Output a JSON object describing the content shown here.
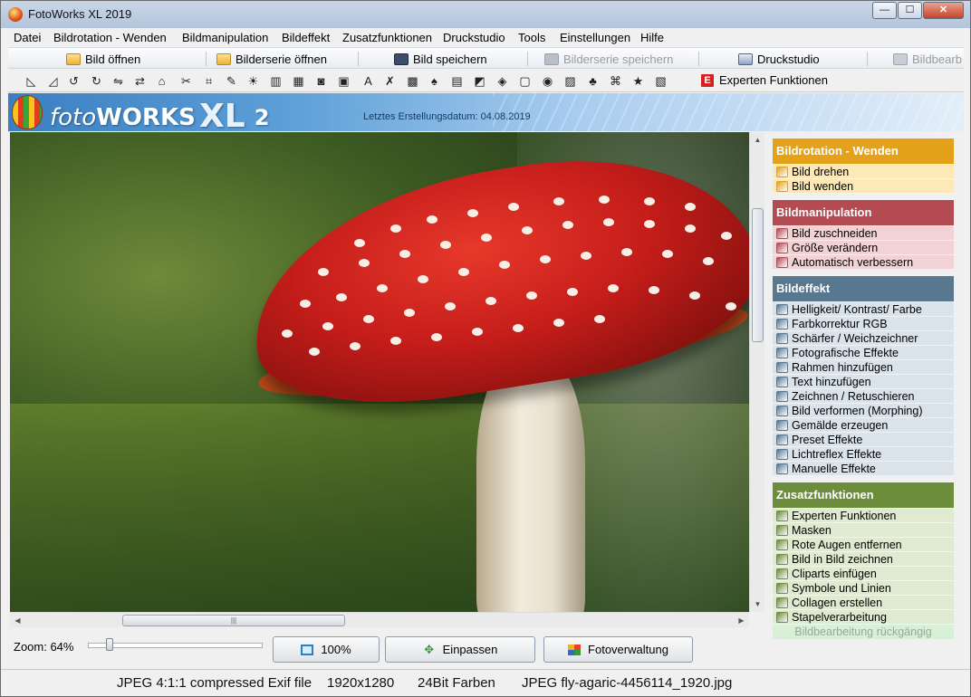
{
  "window": {
    "title": "FotoWorks XL 2019",
    "controls": {
      "minimize": "—",
      "maximize": "☐",
      "close": "✕"
    }
  },
  "menu": [
    "Datei",
    "Bildrotation - Wenden",
    "Bildmanipulation",
    "Bildeffekt",
    "Zusatzfunktionen",
    "Druckstudio",
    "Tools",
    "Einstellungen",
    "Hilfe"
  ],
  "toolbar": {
    "open_image": "Bild öffnen",
    "open_series": "Bilderserie öffnen",
    "save_image": "Bild speichern",
    "save_series": "Bilderserie speichern",
    "print_studio": "Druckstudio",
    "edit_cut": "Bildbearb"
  },
  "icon_toolbar": {
    "icons": [
      "rotate-left-icon",
      "rotate-right-icon",
      "rotate-ccw-icon",
      "rotate-cw-icon",
      "flip-icon",
      "mirror-icon",
      "perspective-icon",
      "scissors-icon",
      "crop-icon",
      "auto-enhance-icon",
      "brightness-icon",
      "rgb-icon",
      "sharpen-icon",
      "photo-effect-icon",
      "frame-icon",
      "text-icon",
      "retouch-icon",
      "morph-icon",
      "paint-icon",
      "preset-icon",
      "lens-flare-icon",
      "manual-effect-icon",
      "mask-icon",
      "red-eye-icon",
      "picture-in-picture-icon",
      "clipart-icon",
      "symbols-icon",
      "collage-icon",
      "batch-icon"
    ],
    "glyphs": [
      "◺",
      "◿",
      "↺",
      "↻",
      "⇋",
      "⇄",
      "⌂",
      "✂",
      "⌗",
      "✎",
      "☀",
      "▥",
      "▦",
      "◙",
      "▣",
      "A",
      "✗",
      "▩",
      "♠",
      "▤",
      "◩",
      "◈",
      "▢",
      "◉",
      "▨",
      "♣",
      "⌘",
      "★",
      "▧"
    ],
    "expert_label": "Experten Funktionen",
    "expert_badge": "E"
  },
  "banner": {
    "logo_foto": "foto",
    "logo_works": "WORKS",
    "logo_xl": "XL",
    "logo_version": "2",
    "date_label": "Letztes Erstellungsdatum: 04.08.2019"
  },
  "zoom": {
    "label": "Zoom: 64%",
    "level": 0.64,
    "btn_100": "100%",
    "btn_fit": "Einpassen",
    "btn_manager": "Fotoverwaltung"
  },
  "side_panel": {
    "sections": [
      {
        "title": "Bildrotation - Wenden",
        "color": "#e4a21a",
        "item_bg": "#fde8b8",
        "items": [
          {
            "label": "Bild drehen",
            "icon": "rotate-image-icon"
          },
          {
            "label": "Bild wenden",
            "icon": "flip-image-icon"
          }
        ]
      },
      {
        "title": "Bildmanipulation",
        "color": "#b44a52",
        "item_bg": "#f2d3d5",
        "items": [
          {
            "label": "Bild zuschneiden",
            "icon": "crop-icon"
          },
          {
            "label": "Größe verändern",
            "icon": "resize-icon"
          },
          {
            "label": "Automatisch verbessern",
            "icon": "auto-enhance-icon"
          }
        ]
      },
      {
        "title": "Bildeffekt",
        "color": "#58788f",
        "item_bg": "#dbe3ea",
        "items": [
          {
            "label": "Helligkeit/ Kontrast/ Farbe",
            "icon": "brightness-icon"
          },
          {
            "label": "Farbkorrektur RGB",
            "icon": "rgb-icon"
          },
          {
            "label": "Schärfer / Weichzeichner",
            "icon": "sharpen-icon"
          },
          {
            "label": "Fotografische Effekte",
            "icon": "camera-icon"
          },
          {
            "label": "Rahmen hinzufügen",
            "icon": "frame-icon"
          },
          {
            "label": "Text hinzufügen",
            "icon": "text-icon"
          },
          {
            "label": "Zeichnen / Retuschieren",
            "icon": "draw-icon"
          },
          {
            "label": "Bild verformen (Morphing)",
            "icon": "morph-icon"
          },
          {
            "label": "Gemälde erzeugen",
            "icon": "paint-icon"
          },
          {
            "label": "Preset Effekte",
            "icon": "preset-icon"
          },
          {
            "label": "Lichtreflex Effekte",
            "icon": "lens-flare-icon"
          },
          {
            "label": "Manuelle Effekte",
            "icon": "manual-effect-icon"
          }
        ]
      },
      {
        "title": "Zusatzfunktionen",
        "color": "#6b8d3c",
        "item_bg": "#e0e9d2",
        "items": [
          {
            "label": "Experten Funktionen",
            "icon": "expert-icon"
          },
          {
            "label": "Masken",
            "icon": "mask-icon"
          },
          {
            "label": "Rote Augen entfernen",
            "icon": "red-eye-icon"
          },
          {
            "label": "Bild in Bild zeichnen",
            "icon": "picture-in-picture-icon"
          },
          {
            "label": "Cliparts einfügen",
            "icon": "clipart-icon"
          },
          {
            "label": "Symbole und Linien",
            "icon": "symbols-icon"
          },
          {
            "label": "Collagen erstellen",
            "icon": "collage-icon"
          },
          {
            "label": "Stapelverarbeitung",
            "icon": "batch-icon"
          }
        ]
      }
    ],
    "undo_label": "Bildbearbeitung rückgängig"
  },
  "status": {
    "format": "JPEG 4:1:1 compressed Exif file",
    "dimensions": "1920x1280",
    "depth": "24Bit Farben",
    "filename": "JPEG fly-agaric-4456114_1920.jpg"
  }
}
